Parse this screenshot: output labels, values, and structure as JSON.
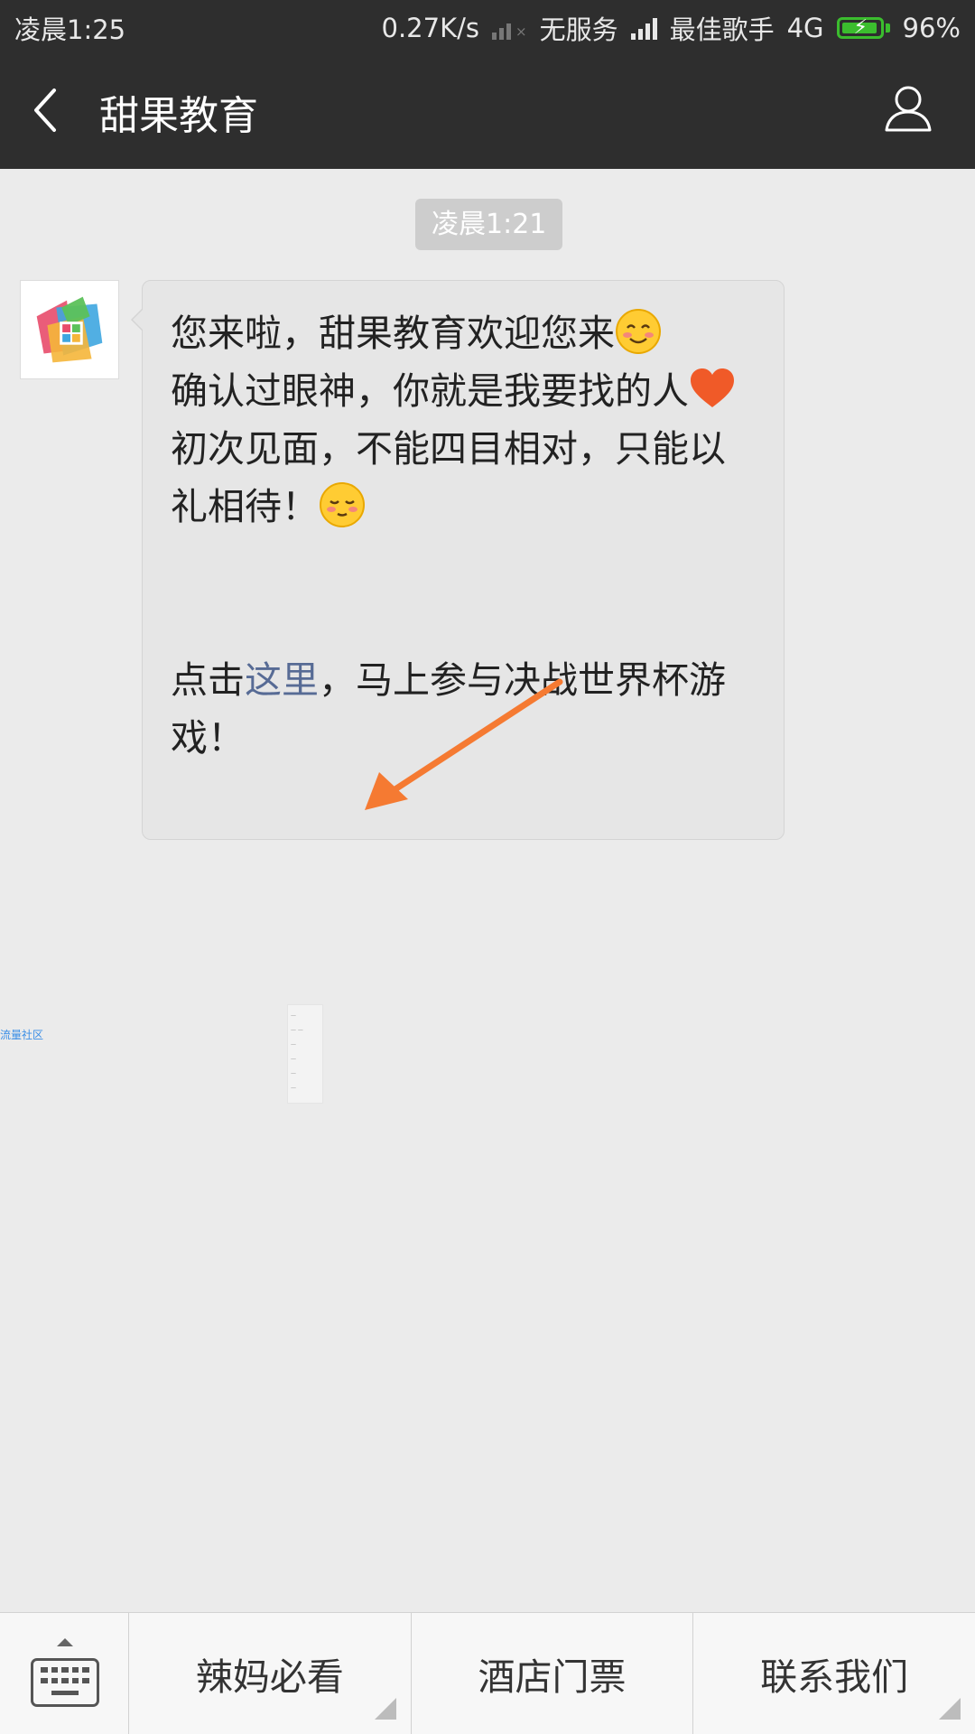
{
  "status_bar": {
    "time": "凌晨1:25",
    "network_speed": "0.27K/s",
    "sim1_label": "无服务",
    "carrier": "最佳歌手",
    "network_type": "4G",
    "battery": "96%"
  },
  "header": {
    "title": "甜果教育"
  },
  "chat": {
    "timestamp": "凌晨1:21",
    "message": {
      "line1": "您来啦，甜果教育欢迎您来",
      "line2": " 确认过眼神，你就是我要找的人",
      "line3": " 初次见面，不能四目相对，只能以礼相待！",
      "action_prefix": "点击",
      "action_link": "这里",
      "action_suffix": "，马上参与决战世界杯游戏！"
    }
  },
  "overlay": {
    "text": "流量社区"
  },
  "menu": {
    "items": [
      "辣妈必看",
      "酒店门票",
      "联系我们"
    ]
  },
  "colors": {
    "header_bg": "#2e2e2e",
    "chat_bg": "#ebebeb",
    "link": "#576b95",
    "arrow": "#f57a32",
    "battery": "#3bbd2e"
  }
}
